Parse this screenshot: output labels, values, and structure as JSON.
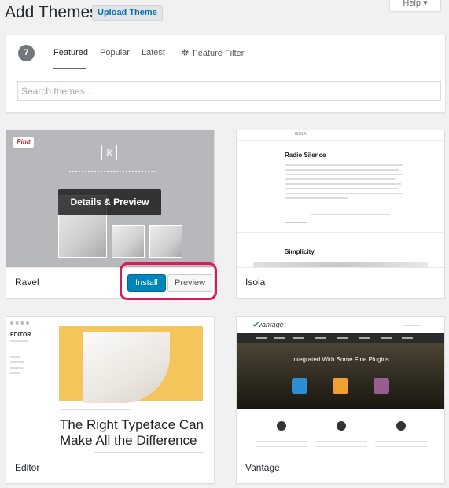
{
  "header": {
    "title": "Add Themes",
    "upload_label": "Upload Theme",
    "help_label": "Help ▾"
  },
  "filter": {
    "count": "7",
    "tabs": [
      "Featured",
      "Popular",
      "Latest",
      "Feature Filter"
    ],
    "active_tab": "Featured",
    "search_placeholder": "Search themes..."
  },
  "themes": [
    {
      "name": "Ravel",
      "overlay_label": "Details & Preview",
      "install_label": "Install",
      "preview_label": "Preview",
      "screenshot": {
        "badge": "Pinit",
        "logo": "R"
      }
    },
    {
      "name": "Isola",
      "screenshot": {
        "brand": "ISOLA",
        "heading1": "Radio Silence",
        "heading2": "Simplicity"
      }
    },
    {
      "name": "Editor",
      "screenshot": {
        "brand": "EDITOR",
        "headline_1": "The Right Typeface Can",
        "headline_2": "Make All the Difference"
      }
    },
    {
      "name": "Vantage",
      "screenshot": {
        "brand": "vantage",
        "hero_title": "Integrated With Some Fine Plugins"
      }
    }
  ],
  "colors": {
    "accent": "#0085ba",
    "highlight": "#d81b5a",
    "background": "#f1f1f1"
  }
}
